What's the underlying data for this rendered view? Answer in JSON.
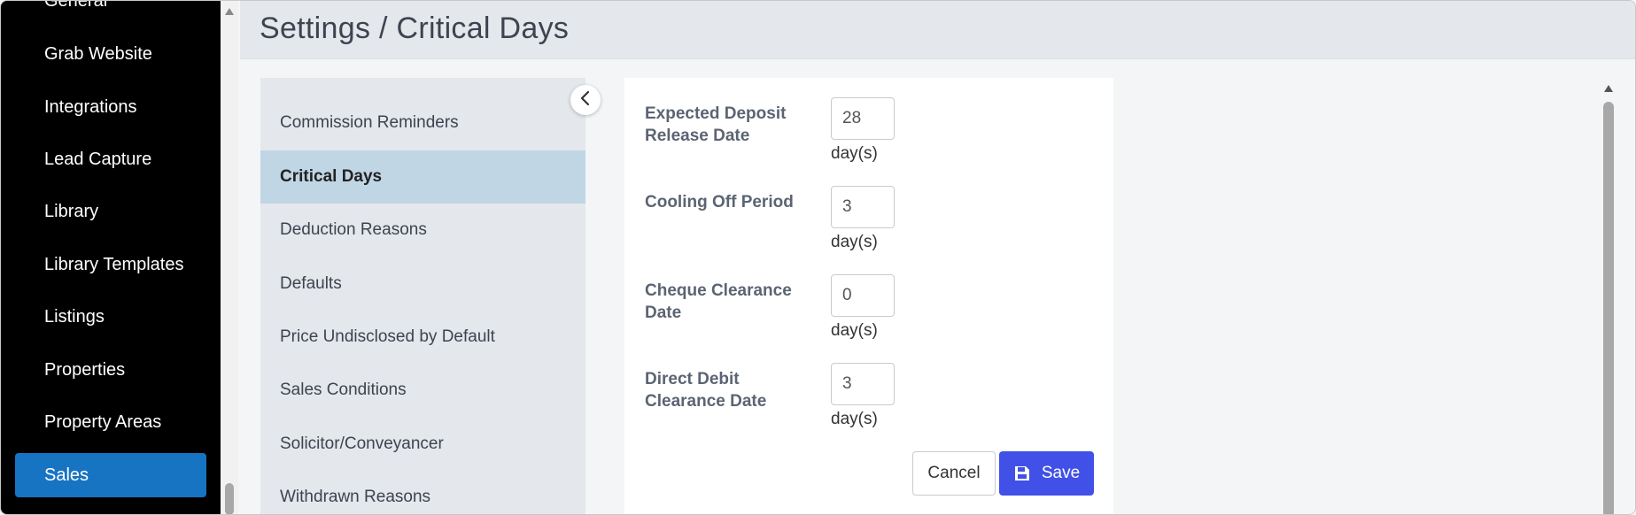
{
  "page": {
    "title": "Settings / Critical Days"
  },
  "sidebar": {
    "items": [
      {
        "label": "General"
      },
      {
        "label": "Grab Website"
      },
      {
        "label": "Integrations"
      },
      {
        "label": "Lead Capture"
      },
      {
        "label": "Library"
      },
      {
        "label": "Library Templates"
      },
      {
        "label": "Listings"
      },
      {
        "label": "Properties"
      },
      {
        "label": "Property Areas"
      },
      {
        "label": "Sales",
        "active": true
      }
    ]
  },
  "submenu": {
    "items": [
      {
        "label": "Commission Reminders"
      },
      {
        "label": "Critical Days",
        "active": true
      },
      {
        "label": "Deduction Reasons"
      },
      {
        "label": "Defaults"
      },
      {
        "label": "Price Undisclosed by Default"
      },
      {
        "label": "Sales Conditions"
      },
      {
        "label": "Solicitor/Conveyancer"
      },
      {
        "label": "Withdrawn Reasons"
      }
    ],
    "collapse_icon": "chevron-left-icon"
  },
  "form": {
    "fields": [
      {
        "label": "Expected Deposit Release Date",
        "value": "28",
        "unit": "day(s)"
      },
      {
        "label": "Cooling Off Period",
        "value": "3",
        "unit": "day(s)"
      },
      {
        "label": "Cheque Clearance Date",
        "value": "0",
        "unit": "day(s)"
      },
      {
        "label": "Direct Debit Clearance Date",
        "value": "3",
        "unit": "day(s)"
      }
    ],
    "cancel_label": "Cancel",
    "save_label": "Save",
    "save_icon": "floppy-disk-icon"
  },
  "colors": {
    "sidebar_bg": "#000000",
    "sidebar_active": "#1774c2",
    "submenu_active": "#c0d6e4",
    "save_button": "#4150e6"
  }
}
